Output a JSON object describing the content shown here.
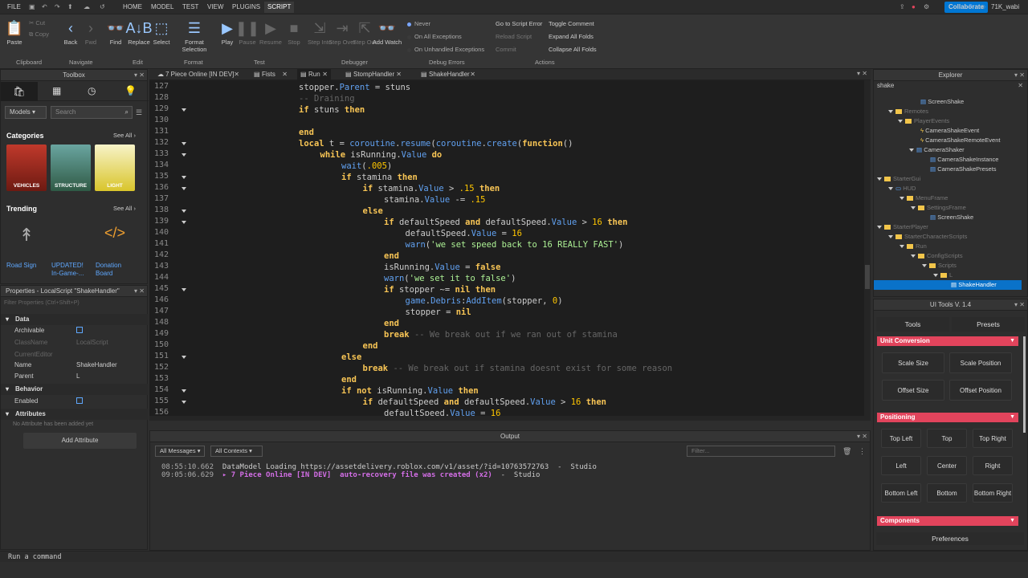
{
  "menu": {
    "items": [
      "FILE",
      "HOME",
      "MODEL",
      "TEST",
      "VIEW",
      "PLUGINS",
      "SCRIPT"
    ],
    "active": "SCRIPT",
    "collaborate": "Collaborate",
    "user": "71K_wabi"
  },
  "ribbon": {
    "paste": "Paste",
    "cut": "Cut",
    "copy": "Copy",
    "back": "Back",
    "fwd": "Fwd",
    "find": "Find",
    "replace": "Replace",
    "select": "Select",
    "format_selection": "Format Selection",
    "play": "Play",
    "pause": "Pause",
    "resume": "Resume",
    "stop": "Stop",
    "step_into": "Step Into",
    "step_over": "Step Over",
    "step_out": "Step Out",
    "add_watch": "Add Watch",
    "err_never": "Never",
    "err_all": "On All Exceptions",
    "err_unhandled": "On Unhandled Exceptions",
    "goto_error": "Go to Script Error",
    "reload_script": "Reload Script",
    "commit": "Commit",
    "toggle_comment": "Toggle Comment",
    "expand_folds": "Expand All Folds",
    "collapse_folds": "Collapse All Folds",
    "groups": [
      "Clipboard",
      "Navigate",
      "Edit",
      "Format",
      "Test",
      "Debugger",
      "Debug Errors",
      "Actions"
    ]
  },
  "tabs": [
    {
      "label": "7 Piece Online [IN DEV]"
    },
    {
      "label": "Fists"
    },
    {
      "label": "Run"
    },
    {
      "label": "StompHandler"
    },
    {
      "label": "ShakeHandler"
    }
  ],
  "editor": {
    "lines": [
      {
        "n": "127",
        "code": [
          [
            "ident",
            "stopper"
          ],
          [
            "plain",
            "."
          ],
          [
            "prop",
            "Parent"
          ],
          [
            "plain",
            " = stuns"
          ]
        ],
        "indent": 0
      },
      {
        "n": "128",
        "code": [
          [
            "cm",
            "-- Draining"
          ]
        ],
        "indent": 0
      },
      {
        "n": "129",
        "code": [
          [
            "kw",
            "if"
          ],
          [
            "plain",
            " stuns "
          ],
          [
            "kw",
            "then"
          ]
        ],
        "indent": 0,
        "fold": true
      },
      {
        "n": "130",
        "code": [],
        "indent": 0
      },
      {
        "n": "131",
        "code": [
          [
            "kw",
            "end"
          ]
        ],
        "indent": 0
      },
      {
        "n": "132",
        "code": [
          [
            "kw",
            "local"
          ],
          [
            "plain",
            " t = "
          ],
          [
            "prop",
            "coroutine"
          ],
          [
            "plain",
            "."
          ],
          [
            "prop",
            "resume"
          ],
          [
            "plain",
            "("
          ],
          [
            "prop",
            "coroutine"
          ],
          [
            "plain",
            "."
          ],
          [
            "prop",
            "create"
          ],
          [
            "plain",
            "("
          ],
          [
            "kw",
            "function"
          ],
          [
            "plain",
            "()"
          ]
        ],
        "indent": 0,
        "fold": true
      },
      {
        "n": "133",
        "code": [
          [
            "kw",
            "while"
          ],
          [
            "plain",
            " isRunning."
          ],
          [
            "prop",
            "Value"
          ],
          [
            "plain",
            " "
          ],
          [
            "kw",
            "do"
          ]
        ],
        "indent": 1,
        "fold": true
      },
      {
        "n": "134",
        "code": [
          [
            "prop",
            "wait"
          ],
          [
            "plain",
            "("
          ],
          [
            "num",
            ".005"
          ],
          [
            "plain",
            ")"
          ]
        ],
        "indent": 2
      },
      {
        "n": "135",
        "code": [
          [
            "kw",
            "if"
          ],
          [
            "plain",
            " stamina "
          ],
          [
            "kw",
            "then"
          ]
        ],
        "indent": 2,
        "fold": true
      },
      {
        "n": "136",
        "code": [
          [
            "kw",
            "if"
          ],
          [
            "plain",
            " stamina."
          ],
          [
            "prop",
            "Value"
          ],
          [
            "plain",
            " > "
          ],
          [
            "num",
            ".15"
          ],
          [
            "plain",
            " "
          ],
          [
            "kw",
            "then"
          ]
        ],
        "indent": 3,
        "fold": true
      },
      {
        "n": "137",
        "code": [
          [
            "plain",
            "stamina."
          ],
          [
            "prop",
            "Value"
          ],
          [
            "plain",
            " -= "
          ],
          [
            "num",
            ".15"
          ]
        ],
        "indent": 4
      },
      {
        "n": "138",
        "code": [
          [
            "kw",
            "else"
          ]
        ],
        "indent": 3,
        "fold": true
      },
      {
        "n": "139",
        "code": [
          [
            "kw",
            "if"
          ],
          [
            "plain",
            " defaultSpeed "
          ],
          [
            "kw",
            "and"
          ],
          [
            "plain",
            " defaultSpeed."
          ],
          [
            "prop",
            "Value"
          ],
          [
            "plain",
            " > "
          ],
          [
            "num",
            "16"
          ],
          [
            "plain",
            " "
          ],
          [
            "kw",
            "then"
          ]
        ],
        "indent": 4,
        "fold": true
      },
      {
        "n": "140",
        "code": [
          [
            "plain",
            "defaultSpeed."
          ],
          [
            "prop",
            "Value"
          ],
          [
            "plain",
            " = "
          ],
          [
            "num",
            "16"
          ]
        ],
        "indent": 5
      },
      {
        "n": "141",
        "code": [
          [
            "prop",
            "warn"
          ],
          [
            "plain",
            "("
          ],
          [
            "str",
            "'we set speed back to 16 REALLY FAST'"
          ],
          [
            "plain",
            ")"
          ]
        ],
        "indent": 5
      },
      {
        "n": "142",
        "code": [
          [
            "kw",
            "end"
          ]
        ],
        "indent": 4
      },
      {
        "n": "143",
        "code": [
          [
            "plain",
            "isRunning."
          ],
          [
            "prop",
            "Value"
          ],
          [
            "plain",
            " = "
          ],
          [
            "kw",
            "false"
          ]
        ],
        "indent": 4
      },
      {
        "n": "144",
        "code": [
          [
            "prop",
            "warn"
          ],
          [
            "plain",
            "("
          ],
          [
            "str",
            "'we set it to false'"
          ],
          [
            "plain",
            ")"
          ]
        ],
        "indent": 4
      },
      {
        "n": "145",
        "code": [
          [
            "kw",
            "if"
          ],
          [
            "plain",
            " stopper ~= "
          ],
          [
            "kw",
            "nil"
          ],
          [
            "plain",
            " "
          ],
          [
            "kw",
            "then"
          ]
        ],
        "indent": 4,
        "fold": true
      },
      {
        "n": "146",
        "code": [
          [
            "prop",
            "game"
          ],
          [
            "plain",
            "."
          ],
          [
            "prop",
            "Debris"
          ],
          [
            "plain",
            ":"
          ],
          [
            "prop",
            "AddItem"
          ],
          [
            "plain",
            "(stopper, "
          ],
          [
            "num",
            "0"
          ],
          [
            "plain",
            ")"
          ]
        ],
        "indent": 5
      },
      {
        "n": "147",
        "code": [
          [
            "plain",
            "stopper = "
          ],
          [
            "kw",
            "nil"
          ]
        ],
        "indent": 5
      },
      {
        "n": "148",
        "code": [
          [
            "kw",
            "end"
          ]
        ],
        "indent": 4
      },
      {
        "n": "149",
        "code": [
          [
            "kw",
            "break"
          ],
          [
            "plain",
            " "
          ],
          [
            "cm",
            "-- We break out if we ran out of stamina"
          ]
        ],
        "indent": 4
      },
      {
        "n": "150",
        "code": [
          [
            "kw",
            "end"
          ]
        ],
        "indent": 3
      },
      {
        "n": "151",
        "code": [
          [
            "kw",
            "else"
          ]
        ],
        "indent": 2,
        "fold": true
      },
      {
        "n": "152",
        "code": [
          [
            "kw",
            "break"
          ],
          [
            "plain",
            " "
          ],
          [
            "cm",
            "-- We break out if stamina doesnt exist for some reason"
          ]
        ],
        "indent": 3
      },
      {
        "n": "153",
        "code": [
          [
            "kw",
            "end"
          ]
        ],
        "indent": 2
      },
      {
        "n": "154",
        "code": [
          [
            "kw",
            "if"
          ],
          [
            "plain",
            " "
          ],
          [
            "kw",
            "not"
          ],
          [
            "plain",
            " isRunning."
          ],
          [
            "prop",
            "Value"
          ],
          [
            "plain",
            " "
          ],
          [
            "kw",
            "then"
          ]
        ],
        "indent": 2,
        "fold": true
      },
      {
        "n": "155",
        "code": [
          [
            "kw",
            "if"
          ],
          [
            "plain",
            " defaultSpeed "
          ],
          [
            "kw",
            "and"
          ],
          [
            "plain",
            " defaultSpeed."
          ],
          [
            "prop",
            "Value"
          ],
          [
            "plain",
            " > "
          ],
          [
            "num",
            "16"
          ],
          [
            "plain",
            " "
          ],
          [
            "kw",
            "then"
          ]
        ],
        "indent": 3,
        "fold": true
      },
      {
        "n": "156",
        "code": [
          [
            "plain",
            "defaultSpeed."
          ],
          [
            "prop",
            "Value"
          ],
          [
            "plain",
            " = "
          ],
          [
            "num",
            "16"
          ]
        ],
        "indent": 4
      }
    ]
  },
  "toolbox": {
    "title": "Toolbox",
    "dropdown": "Models",
    "search_placeholder": "Search",
    "categories_label": "Categories",
    "see_all": "See All",
    "cards": [
      "VEHICLES",
      "STRUCTURE",
      "LIGHT"
    ],
    "trending_label": "Trending",
    "trending": [
      {
        "name": "Road Sign"
      },
      {
        "name": "UPDATED! In-Game-..."
      },
      {
        "name": "Donation Board"
      }
    ]
  },
  "properties": {
    "title": "Properties - LocalScript \"ShakeHandler\"",
    "filter_placeholder": "Filter Properties (Ctrl+Shift+P)",
    "sec_data": "Data",
    "sec_behavior": "Behavior",
    "sec_attributes": "Attributes",
    "rows": [
      {
        "k": "Archivable",
        "v": ""
      },
      {
        "k": "ClassName",
        "v": "LocalScript"
      },
      {
        "k": "CurrentEditor",
        "v": ""
      },
      {
        "k": "Name",
        "v": "ShakeHandler"
      },
      {
        "k": "Parent",
        "v": "L"
      }
    ],
    "enabled": "Enabled",
    "no_attr": "No Attribute has been added yet",
    "add_attr": "Add Attribute"
  },
  "explorer": {
    "title": "Explorer",
    "filter": "shake",
    "items": [
      "ScreenShake",
      "Remotes",
      "PlayerEvents",
      "CameraShakeEvent",
      "CameraShakeRemoteEvent",
      "CameraShaker",
      "CameraShakeInstance",
      "CameraShakePresets",
      "StarterGui",
      "HUD",
      "MenuFrame",
      "SettingsFrame",
      "ScreenShake",
      "StarterPlayer",
      "StarterCharacterScripts",
      "Run",
      "ConfigScripts",
      "Scripts",
      "L",
      "ShakeHandler"
    ]
  },
  "uitools": {
    "title": "UI Tools V. 1.4",
    "tab_tools": "Tools",
    "tab_presets": "Presets",
    "unit_conversion": "Unit Conversion",
    "scale_size": "Scale Size",
    "scale_position": "Scale Position",
    "offset_size": "Offset Size",
    "offset_position": "Offset Position",
    "positioning": "Positioning",
    "pos": [
      "Top Left",
      "Top",
      "Top Right",
      "Left",
      "Center",
      "Right",
      "Bottom Left",
      "Bottom",
      "Bottom Right"
    ],
    "components": "Components",
    "preferences": "Preferences"
  },
  "output": {
    "title": "Output",
    "filter_messages": "All Messages",
    "filter_contexts": "All Contexts",
    "filter_placeholder": "Filter...",
    "logs": [
      {
        "time": "08:55:10.662",
        "msg": "DataModel Loading https://assetdelivery.roblox.com/v1/asset/?id=10763572763",
        "src": "Studio"
      },
      {
        "time": "09:05:06.629",
        "msg": "▸ 7 Piece Online [IN DEV]  auto-recovery file was created (x2)",
        "src": "Studio"
      }
    ]
  },
  "command": {
    "placeholder": "Run a command"
  },
  "colors": {
    "accent": "#0077d4",
    "uitools_red": "#e2445c",
    "selected": "#0a72c9"
  }
}
